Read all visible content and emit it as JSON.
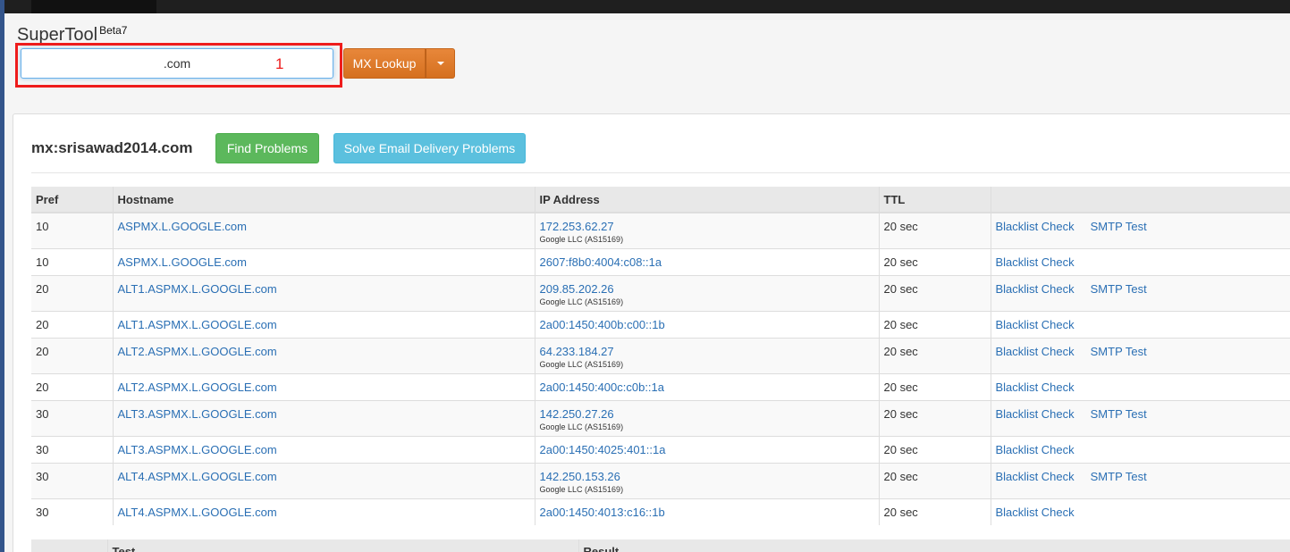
{
  "app": {
    "brand": "SuperTool",
    "beta": "Beta7"
  },
  "search": {
    "value": ".com",
    "annotation": "1"
  },
  "lookup": {
    "label": "MX Lookup"
  },
  "result": {
    "title": "mx:srisawad2014.com",
    "find_label": "Find Problems",
    "solve_label": "Solve Email Delivery Problems"
  },
  "table": {
    "headers": [
      "Pref",
      "Hostname",
      "IP Address",
      "TTL",
      ""
    ],
    "rows": [
      {
        "pref": "10",
        "host": "ASPMX.L.GOOGLE.com",
        "ip": "172.253.62.27",
        "asn": "Google LLC (AS15169)",
        "ttl": "20 sec",
        "blacklist": "Blacklist Check",
        "smtp": "SMTP Test"
      },
      {
        "pref": "10",
        "host": "ASPMX.L.GOOGLE.com",
        "ip": "2607:f8b0:4004:c08::1a",
        "asn": "",
        "ttl": "20 sec",
        "blacklist": "Blacklist Check",
        "smtp": ""
      },
      {
        "pref": "20",
        "host": "ALT1.ASPMX.L.GOOGLE.com",
        "ip": "209.85.202.26",
        "asn": "Google LLC (AS15169)",
        "ttl": "20 sec",
        "blacklist": "Blacklist Check",
        "smtp": "SMTP Test"
      },
      {
        "pref": "20",
        "host": "ALT1.ASPMX.L.GOOGLE.com",
        "ip": "2a00:1450:400b:c00::1b",
        "asn": "",
        "ttl": "20 sec",
        "blacklist": "Blacklist Check",
        "smtp": ""
      },
      {
        "pref": "20",
        "host": "ALT2.ASPMX.L.GOOGLE.com",
        "ip": "64.233.184.27",
        "asn": "Google LLC (AS15169)",
        "ttl": "20 sec",
        "blacklist": "Blacklist Check",
        "smtp": "SMTP Test"
      },
      {
        "pref": "20",
        "host": "ALT2.ASPMX.L.GOOGLE.com",
        "ip": "2a00:1450:400c:c0b::1a",
        "asn": "",
        "ttl": "20 sec",
        "blacklist": "Blacklist Check",
        "smtp": ""
      },
      {
        "pref": "30",
        "host": "ALT3.ASPMX.L.GOOGLE.com",
        "ip": "142.250.27.26",
        "asn": "Google LLC (AS15169)",
        "ttl": "20 sec",
        "blacklist": "Blacklist Check",
        "smtp": "SMTP Test"
      },
      {
        "pref": "30",
        "host": "ALT3.ASPMX.L.GOOGLE.com",
        "ip": "2a00:1450:4025:401::1a",
        "asn": "",
        "ttl": "20 sec",
        "blacklist": "Blacklist Check",
        "smtp": ""
      },
      {
        "pref": "30",
        "host": "ALT4.ASPMX.L.GOOGLE.com",
        "ip": "142.250.153.26",
        "asn": "Google LLC (AS15169)",
        "ttl": "20 sec",
        "blacklist": "Blacklist Check",
        "smtp": "SMTP Test"
      },
      {
        "pref": "30",
        "host": "ALT4.ASPMX.L.GOOGLE.com",
        "ip": "2a00:1450:4013:c16::1b",
        "asn": "",
        "ttl": "20 sec",
        "blacklist": "Blacklist Check",
        "smtp": ""
      }
    ]
  },
  "tests_table": {
    "headers": [
      "",
      "Test",
      "Result"
    ]
  }
}
